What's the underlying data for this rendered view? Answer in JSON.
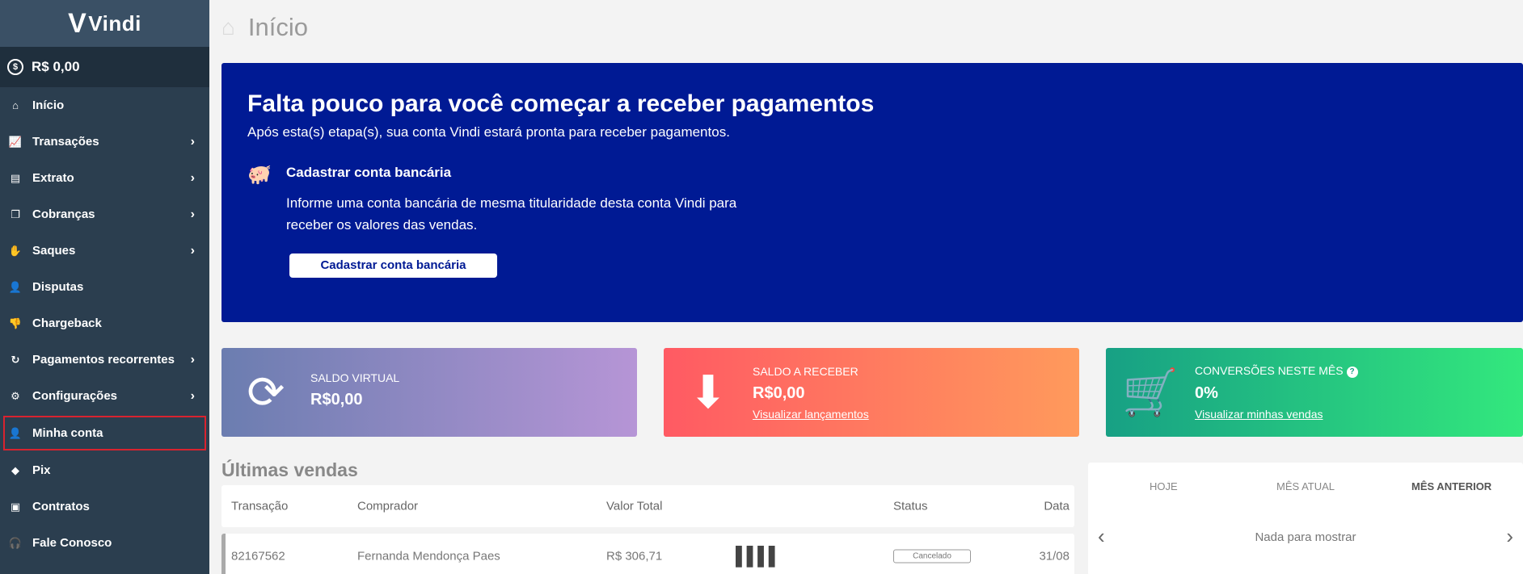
{
  "brand": {
    "logo_text": "Vindi"
  },
  "sidebar": {
    "balance": "R$ 0,00",
    "items": [
      {
        "label": "Início",
        "icon": "home-icon",
        "chevron": false
      },
      {
        "label": "Transações",
        "icon": "chart-line-icon",
        "chevron": true
      },
      {
        "label": "Extrato",
        "icon": "receipt-icon",
        "chevron": true
      },
      {
        "label": "Cobranças",
        "icon": "invoices-icon",
        "chevron": true
      },
      {
        "label": "Saques",
        "icon": "hand-coin-icon",
        "chevron": true
      },
      {
        "label": "Disputas",
        "icon": "user-dispute-icon",
        "chevron": false
      },
      {
        "label": "Chargeback",
        "icon": "thumbs-down-icon",
        "chevron": false
      },
      {
        "label": "Pagamentos recorrentes",
        "icon": "refresh-icon",
        "chevron": true
      },
      {
        "label": "Configurações",
        "icon": "gear-icon",
        "chevron": true
      },
      {
        "label": "Minha conta",
        "icon": "user-settings-icon",
        "chevron": false,
        "active": true
      },
      {
        "label": "Pix",
        "icon": "pix-icon",
        "chevron": false
      },
      {
        "label": "Contratos",
        "icon": "wallet-icon",
        "chevron": false
      },
      {
        "label": "Fale Conosco",
        "icon": "headset-icon",
        "chevron": false
      }
    ]
  },
  "header": {
    "title": "Início"
  },
  "banner": {
    "title": "Falta pouco para você começar a receber pagamentos",
    "subtitle": "Após esta(s) etapa(s), sua conta Vindi estará pronta para receber pagamentos.",
    "step_title": "Cadastrar conta bancária",
    "step_text": "Informe uma conta bancária de mesma titularidade desta conta Vindi para receber os valores das vendas.",
    "step_button": "Cadastrar conta bancária"
  },
  "cards": {
    "virtual": {
      "label": "SALDO VIRTUAL",
      "value": "R$0,00"
    },
    "receivable": {
      "label": "SALDO A RECEBER",
      "value": "R$0,00",
      "link": "Visualizar lançamentos"
    },
    "conversions": {
      "label": "CONVERSÕES NESTE MÊS",
      "value": "0%",
      "link": "Visualizar minhas vendas",
      "help": "?"
    }
  },
  "sales": {
    "title": "Últimas vendas",
    "columns": {
      "transaction": "Transação",
      "buyer": "Comprador",
      "total": "Valor Total",
      "status": "Status",
      "date": "Data"
    },
    "rows": [
      {
        "transaction": "82167562",
        "buyer": "Fernanda Mendonça Paes",
        "total": "R$ 306,71",
        "method_icon": "barcode-icon",
        "status": "Cancelado",
        "date": "31/08"
      }
    ]
  },
  "period": {
    "tabs": [
      "HOJE",
      "MÊS ATUAL",
      "MÊS ANTERIOR"
    ],
    "selected": "MÊS ANTERIOR",
    "empty": "Nada para mostrar"
  },
  "colors": {
    "sidebar": "#2b3e4f",
    "banner": "#001a94",
    "active_outline": "#d9232f",
    "card_virtual": "#6b7db0",
    "card_receivable": "#ff5a63",
    "card_conversions": "#17a084"
  }
}
